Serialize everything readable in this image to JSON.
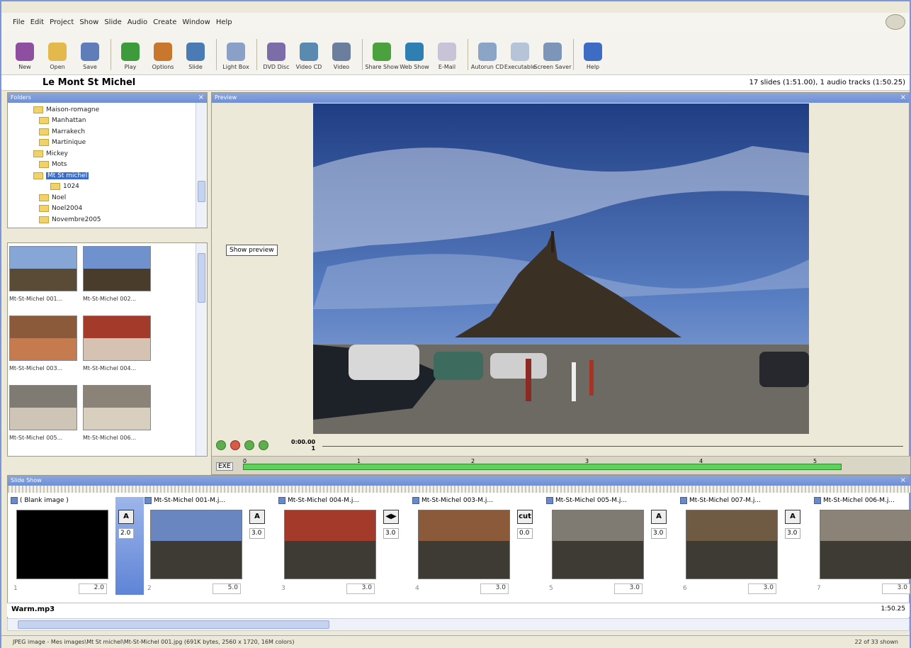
{
  "menu": [
    "File",
    "Edit",
    "Project",
    "Show",
    "Slide",
    "Audio",
    "Create",
    "Window",
    "Help"
  ],
  "toolbar": [
    {
      "label": "New",
      "color": "#8e4fa0"
    },
    {
      "label": "Open",
      "color": "#e3b84c"
    },
    {
      "label": "Save",
      "color": "#5f7db8"
    },
    {
      "label": "Play",
      "color": "#3d9b3d"
    },
    {
      "label": "Options",
      "color": "#c9762f"
    },
    {
      "label": "Slide",
      "color": "#4b7bb5"
    },
    {
      "label": "Light Box",
      "color": "#8aa0c6"
    },
    {
      "label": "DVD Disc",
      "color": "#7c6da8"
    },
    {
      "label": "Video CD",
      "color": "#5a8ab0"
    },
    {
      "label": "Video",
      "color": "#6c7e9e"
    },
    {
      "label": "Share Show",
      "color": "#4aa13d"
    },
    {
      "label": "Web Show",
      "color": "#2f7fb3"
    },
    {
      "label": "E-Mail",
      "color": "#c8c3d6"
    },
    {
      "label": "Autorun CD",
      "color": "#8aa5c6"
    },
    {
      "label": "Executable",
      "color": "#b6c4d8"
    },
    {
      "label": "Screen Saver",
      "color": "#7c95b8"
    },
    {
      "label": "Help",
      "color": "#3e6cc4"
    }
  ],
  "project": {
    "title": "Le Mont St Michel",
    "info": "17 slides (1:51.00), 1 audio tracks (1:50.25)"
  },
  "folders": {
    "title": "Folders",
    "items": [
      "Maison-romagne",
      "Manhattan",
      "Marrakech",
      "Martinique",
      "Mickey",
      "Mots",
      "Mt St michel",
      "1024",
      "Noel",
      "Noel2004",
      "Novembre2005"
    ]
  },
  "thumbs": [
    "Mt-St-Michel 001...",
    "Mt-St-Michel 002...",
    "Mt-St-Michel 003...",
    "Mt-St-Michel 004...",
    "Mt-St-Michel 005...",
    "Mt-St-Michel 006..."
  ],
  "preview": {
    "title": "Preview",
    "tooltip": "Show preview",
    "time": "0:00.00",
    "frame": "1",
    "exe": "EXE",
    "ticks": [
      "0",
      "1",
      "2",
      "3",
      "4",
      "5"
    ]
  },
  "slideshow": {
    "title": "Slide Show"
  },
  "slides": [
    {
      "name": "( Blank image )",
      "num": "1",
      "dur": "2.0"
    },
    {
      "name": "Mt-St-Michel 001-M.j...",
      "num": "2",
      "dur": "5.0"
    },
    {
      "name": "Mt-St-Michel 004-M.j...",
      "num": "3",
      "dur": "3.0"
    },
    {
      "name": "Mt-St-Michel 003-M.j...",
      "num": "4",
      "dur": "3.0"
    },
    {
      "name": "Mt-St-Michel 005-M.j...",
      "num": "5",
      "dur": "3.0"
    },
    {
      "name": "Mt-St-Michel 007-M.j...",
      "num": "6",
      "dur": "3.0"
    },
    {
      "name": "Mt-St-Michel 006-M.j...",
      "num": "7",
      "dur": "3.0"
    }
  ],
  "transitions": [
    {
      "label": "A",
      "dur": "2.0"
    },
    {
      "label": "A",
      "dur": "3.0"
    },
    {
      "label": "◀▶",
      "dur": "3.0"
    },
    {
      "label": "cut",
      "dur": "0.0"
    },
    {
      "label": "A",
      "dur": "3.0"
    },
    {
      "label": "A",
      "dur": "3.0"
    }
  ],
  "audio": {
    "name": "Warm.mp3",
    "length": "1:50.25"
  },
  "status": {
    "left": "JPEG image - Mes images\\Mt St michel\\Mt-St-Michel 001.jpg  (691K bytes, 2560 x 1720, 16M colors)",
    "right": "22 of 33 shown"
  }
}
